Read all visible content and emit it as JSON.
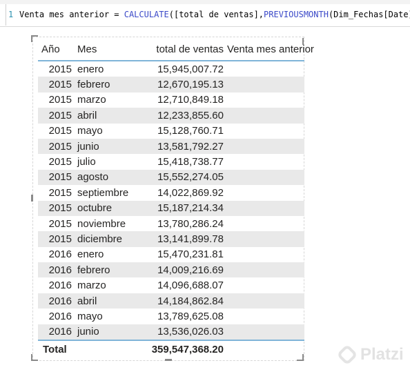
{
  "formula": {
    "line_number": "1",
    "measure_name": "Venta mes anterior = ",
    "fn_calculate": "CALCULATE",
    "arg_measure": "([total de ventas],",
    "fn_previousmonth": "PREVIOUSMONTH",
    "arg_column": "(Dim_Fechas[Date]))"
  },
  "table": {
    "headers": {
      "year": "Año",
      "month": "Mes",
      "total": "total de ventas",
      "previous": "Venta mes anterior"
    },
    "rows": [
      {
        "year": "2015",
        "month": "enero",
        "total": "15,945,007.72",
        "previous": ""
      },
      {
        "year": "2015",
        "month": "febrero",
        "total": "12,670,195.13",
        "previous": ""
      },
      {
        "year": "2015",
        "month": "marzo",
        "total": "12,710,849.18",
        "previous": ""
      },
      {
        "year": "2015",
        "month": "abril",
        "total": "12,233,855.60",
        "previous": ""
      },
      {
        "year": "2015",
        "month": "mayo",
        "total": "15,128,760.71",
        "previous": ""
      },
      {
        "year": "2015",
        "month": "junio",
        "total": "13,581,792.27",
        "previous": ""
      },
      {
        "year": "2015",
        "month": "julio",
        "total": "15,418,738.77",
        "previous": ""
      },
      {
        "year": "2015",
        "month": "agosto",
        "total": "15,552,274.05",
        "previous": ""
      },
      {
        "year": "2015",
        "month": "septiembre",
        "total": "14,022,869.92",
        "previous": ""
      },
      {
        "year": "2015",
        "month": "octubre",
        "total": "15,187,214.34",
        "previous": ""
      },
      {
        "year": "2015",
        "month": "noviembre",
        "total": "13,780,286.24",
        "previous": ""
      },
      {
        "year": "2015",
        "month": "diciembre",
        "total": "13,141,899.78",
        "previous": ""
      },
      {
        "year": "2016",
        "month": "enero",
        "total": "15,470,231.81",
        "previous": ""
      },
      {
        "year": "2016",
        "month": "febrero",
        "total": "14,009,216.69",
        "previous": ""
      },
      {
        "year": "2016",
        "month": "marzo",
        "total": "14,096,688.07",
        "previous": ""
      },
      {
        "year": "2016",
        "month": "abril",
        "total": "14,184,862.84",
        "previous": ""
      },
      {
        "year": "2016",
        "month": "mayo",
        "total": "13,789,625.08",
        "previous": ""
      },
      {
        "year": "2016",
        "month": "junio",
        "total": "13,536,026.03",
        "previous": ""
      }
    ],
    "total_label": "Total",
    "total_value": "359,547,368.20"
  },
  "watermark": {
    "text": "Platzi",
    "icon": "platzi-logo-icon"
  },
  "colors": {
    "header_rule": "#7fb4d8",
    "stripe": "#e9e9e9",
    "dax_function": "#3b49c8"
  }
}
